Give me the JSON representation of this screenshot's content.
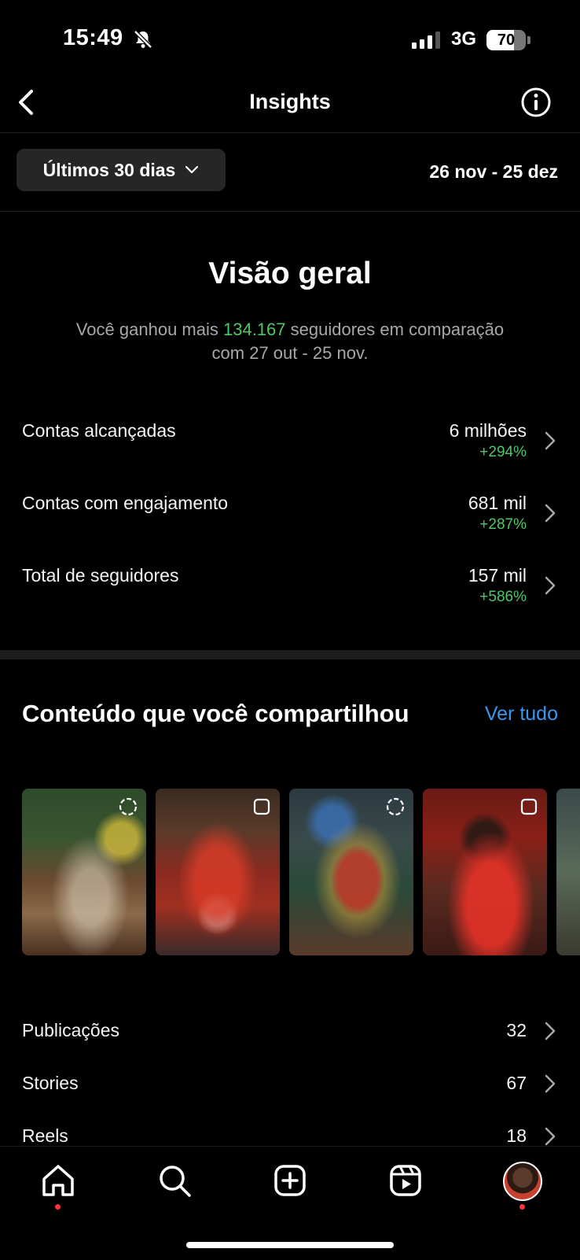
{
  "status_bar": {
    "time": "15:49",
    "network": "3G",
    "battery": 70,
    "icons": [
      "bell-slash-icon",
      "signal-icon",
      "battery-icon"
    ]
  },
  "header": {
    "title": "Insights",
    "back_icon": "chevron-left-icon",
    "info_icon": "info-icon"
  },
  "range": {
    "selector_label": "Últimos 30 dias",
    "dates": "26 nov - 25 dez"
  },
  "overview": {
    "title": "Visão geral",
    "desc_prefix": "Você ganhou mais",
    "desc_number": "134.167",
    "desc_suffix": "seguidores em comparação",
    "desc_line2": "com 27 out - 25 nov.",
    "metrics": [
      {
        "label": "Contas alcançadas",
        "value": "6 milhões",
        "change": "+294%"
      },
      {
        "label": "Contas com engajamento",
        "value": "681 mil",
        "change": "+287%"
      },
      {
        "label": "Total de seguidores",
        "value": "157 mil",
        "change": "+586%"
      }
    ]
  },
  "content": {
    "title": "Conteúdo que você compartilhou",
    "see_all": "Ver tudo",
    "thumbnails": [
      {
        "type": "story",
        "icon": "story-ring-icon"
      },
      {
        "type": "post",
        "icon": "square-icon"
      },
      {
        "type": "story",
        "icon": "story-ring-icon"
      },
      {
        "type": "post",
        "icon": "square-icon"
      }
    ],
    "rows": [
      {
        "label": "Publicações",
        "value": "32"
      },
      {
        "label": "Stories",
        "value": "67"
      },
      {
        "label": "Reels",
        "value": "18"
      }
    ]
  },
  "tab_bar": {
    "items": [
      "home-icon",
      "search-icon",
      "create-icon",
      "reels-icon",
      "profile-avatar"
    ]
  },
  "colors": {
    "accent_green": "#4fc867",
    "link_blue": "#3897f0",
    "background": "#000000",
    "notification_dot": "#ff3040"
  }
}
